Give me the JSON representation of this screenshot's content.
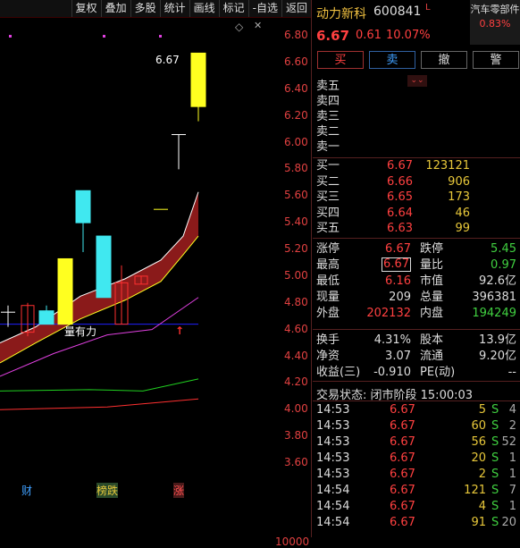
{
  "toolbar": [
    "复权",
    "叠加",
    "多股",
    "统计",
    "画线",
    "标记",
    "-自选",
    "返回"
  ],
  "y_axis": [
    "6.80",
    "6.60",
    "6.40",
    "6.20",
    "6.00",
    "5.80",
    "5.60",
    "5.40",
    "5.20",
    "5.00",
    "4.80",
    "4.60",
    "4.40",
    "4.20",
    "4.00",
    "3.80",
    "3.60"
  ],
  "volume_axis_label": "10000",
  "chart_annotations": {
    "high_label": "6.67",
    "indicator_label": "量有力",
    "event_labels": [
      "财",
      "榜跌",
      "涨"
    ]
  },
  "stock": {
    "name": "动力新科",
    "code": "600841",
    "flag": "L",
    "price": "6.67",
    "change": "0.61",
    "change_pct": "10.07%",
    "sector_name": "汽车零部件",
    "sector_pct": "0.83%"
  },
  "trade_buttons": [
    "买",
    "卖",
    "撤",
    "警"
  ],
  "sell_orders": [
    {
      "label": "卖五",
      "price": "",
      "vol": ""
    },
    {
      "label": "卖四",
      "price": "",
      "vol": ""
    },
    {
      "label": "卖三",
      "price": "",
      "vol": ""
    },
    {
      "label": "卖二",
      "price": "",
      "vol": ""
    },
    {
      "label": "卖一",
      "price": "",
      "vol": ""
    }
  ],
  "buy_orders": [
    {
      "label": "买一",
      "price": "6.67",
      "vol": "123121"
    },
    {
      "label": "买二",
      "price": "6.66",
      "vol": "906"
    },
    {
      "label": "买三",
      "price": "6.65",
      "vol": "173"
    },
    {
      "label": "买四",
      "price": "6.64",
      "vol": "46"
    },
    {
      "label": "买五",
      "price": "6.63",
      "vol": "99"
    }
  ],
  "quote": {
    "zhangting_label": "涨停",
    "zhangting": "6.67",
    "dieting_label": "跌停",
    "dieting": "5.45",
    "high_label": "最高",
    "high": "6.67",
    "liangbi_label": "量比",
    "liangbi": "0.97",
    "low_label": "最低",
    "low": "6.16",
    "mktcap_label": "市值",
    "mktcap": "92.6亿",
    "curvol_label": "现量",
    "curvol": "209",
    "totalvol_label": "总量",
    "totalvol": "396381",
    "outer_label": "外盘",
    "outer": "202132",
    "inner_label": "内盘",
    "inner": "194249",
    "turnover_label": "换手",
    "turnover": "4.31%",
    "equity_label": "股本",
    "equity": "13.9亿",
    "netasset_label": "净资",
    "netasset": "3.07",
    "float_label": "流通",
    "float": "9.20亿",
    "eps_label": "收益(三)",
    "eps": "-0.910",
    "pe_label": "PE(动)",
    "pe": "--"
  },
  "status_label": "交易状态: 闭市阶段 15:00:03",
  "ticks": [
    {
      "time": "14:53",
      "price": "6.67",
      "vol": "5",
      "bs": "S",
      "n": "4"
    },
    {
      "time": "14:53",
      "price": "6.67",
      "vol": "60",
      "bs": "S",
      "n": "2"
    },
    {
      "time": "14:53",
      "price": "6.67",
      "vol": "56",
      "bs": "S",
      "n": "52"
    },
    {
      "time": "14:53",
      "price": "6.67",
      "vol": "20",
      "bs": "S",
      "n": "1"
    },
    {
      "time": "14:53",
      "price": "6.67",
      "vol": "2",
      "bs": "S",
      "n": "1"
    },
    {
      "time": "14:54",
      "price": "6.67",
      "vol": "121",
      "bs": "S",
      "n": "7"
    },
    {
      "time": "14:54",
      "price": "6.67",
      "vol": "4",
      "bs": "S",
      "n": "1"
    },
    {
      "time": "14:54",
      "price": "6.67",
      "vol": "91",
      "bs": "S",
      "n": "20"
    }
  ],
  "chart_data": {
    "type": "candlestick",
    "candles": [
      {
        "open": 4.64,
        "close": 4.73,
        "high": 4.78,
        "low": 4.62,
        "color": "white-cross"
      },
      {
        "open": 4.58,
        "close": 4.78,
        "high": 4.8,
        "low": 4.55,
        "color": "red-hollow"
      },
      {
        "open": 4.64,
        "close": 4.74,
        "high": 4.78,
        "low": 4.64,
        "color": "cyan"
      },
      {
        "open": 4.64,
        "close": 5.13,
        "high": 5.13,
        "low": 4.64,
        "color": "yellow"
      },
      {
        "open": 5.4,
        "close": 5.64,
        "high": 5.64,
        "low": 5.18,
        "color": "cyan"
      },
      {
        "open": 4.84,
        "close": 5.3,
        "high": 5.3,
        "low": 4.84,
        "color": "cyan"
      },
      {
        "open": 4.64,
        "close": 4.95,
        "high": 5.08,
        "low": 4.64,
        "color": "red-hollow"
      },
      {
        "open": 4.94,
        "close": 5.0,
        "high": 5.0,
        "low": 4.94,
        "color": "red-hollow"
      },
      {
        "open": 5.5,
        "close": 5.5,
        "high": 5.5,
        "low": 5.5,
        "color": "yellow-doji"
      },
      {
        "open": 6.06,
        "close": 6.06,
        "high": 6.06,
        "low": 5.8,
        "color": "white-cross"
      },
      {
        "open": 6.27,
        "close": 6.67,
        "high": 6.67,
        "low": 6.16,
        "color": "yellow"
      }
    ],
    "ylim": [
      3.5,
      6.9
    ],
    "colors": {
      "up": "#ff3030",
      "cyan": "#40e8f0",
      "yellow": "#ffff20",
      "band": "#8a1a1a",
      "ma_green": "#20d020",
      "ma_magenta": "#e040e0",
      "baseline": "#2020ff"
    }
  }
}
